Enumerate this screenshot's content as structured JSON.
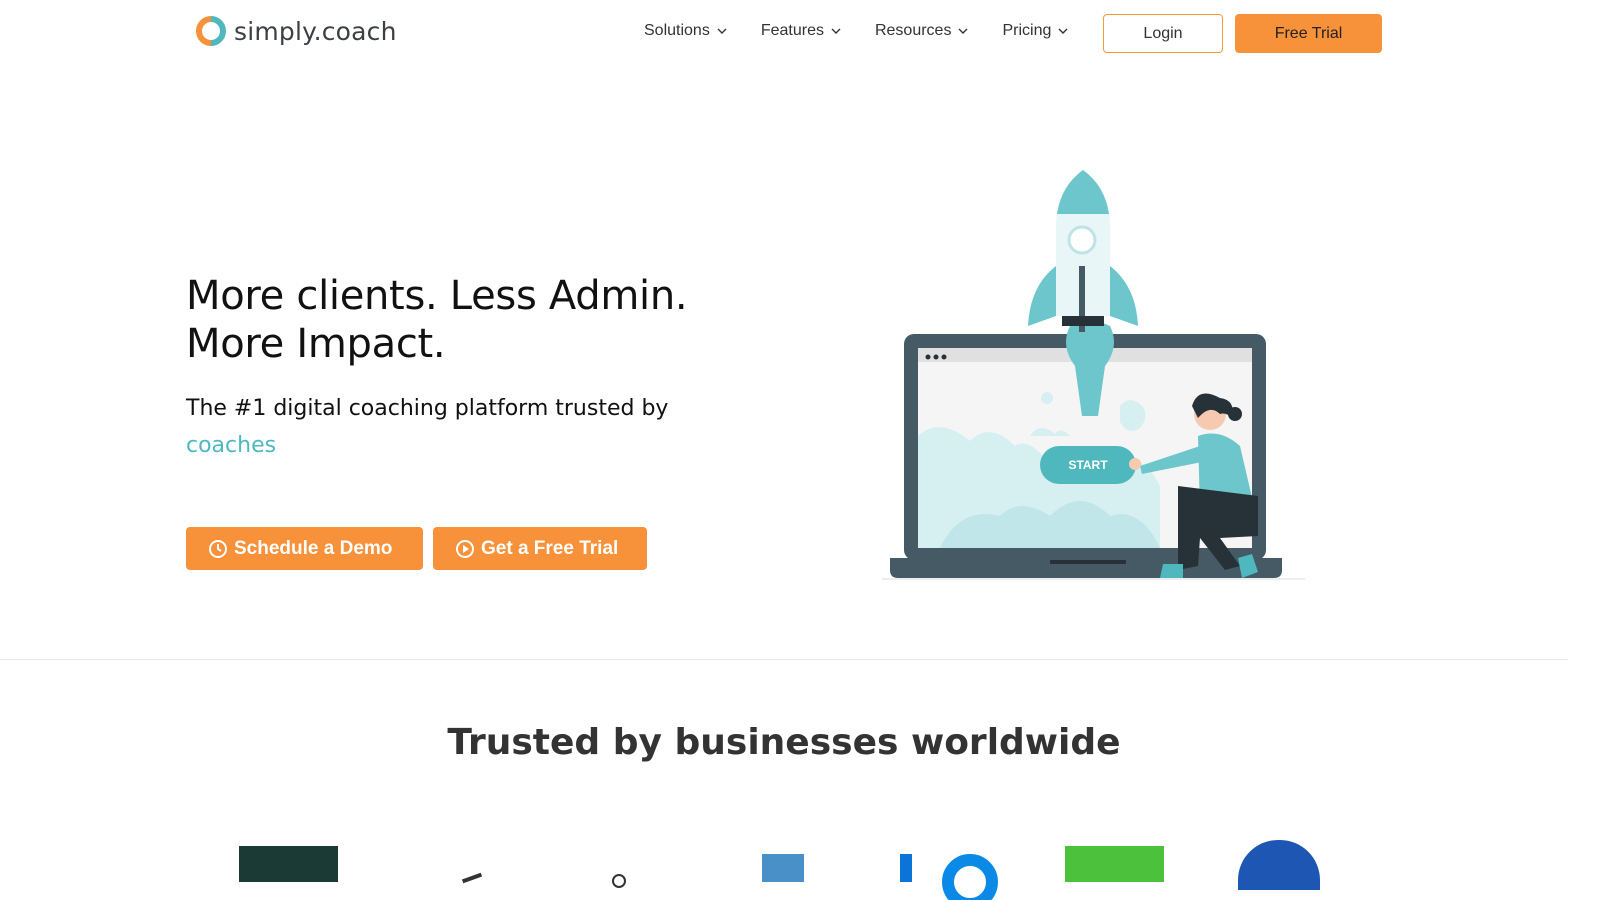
{
  "header": {
    "brand_name": "simply.coach",
    "nav": [
      {
        "label": "Solutions"
      },
      {
        "label": "Features"
      },
      {
        "label": "Resources"
      },
      {
        "label": "Pricing"
      }
    ],
    "login_label": "Login",
    "free_trial_label": "Free Trial"
  },
  "hero": {
    "title_line1": "More clients. Less Admin.",
    "title_line2": "More Impact.",
    "subtitle": "The #1 digital coaching platform trusted by",
    "subtitle_accent": "coaches",
    "demo_label": "Schedule a Demo",
    "trial_label": "Get a Free Trial",
    "illustration_button": "START"
  },
  "trusted": {
    "heading": "Trusted by businesses worldwide"
  },
  "colors": {
    "accent_orange": "#f7913a",
    "accent_teal": "#4fb8bf",
    "text_dark": "#111111"
  }
}
